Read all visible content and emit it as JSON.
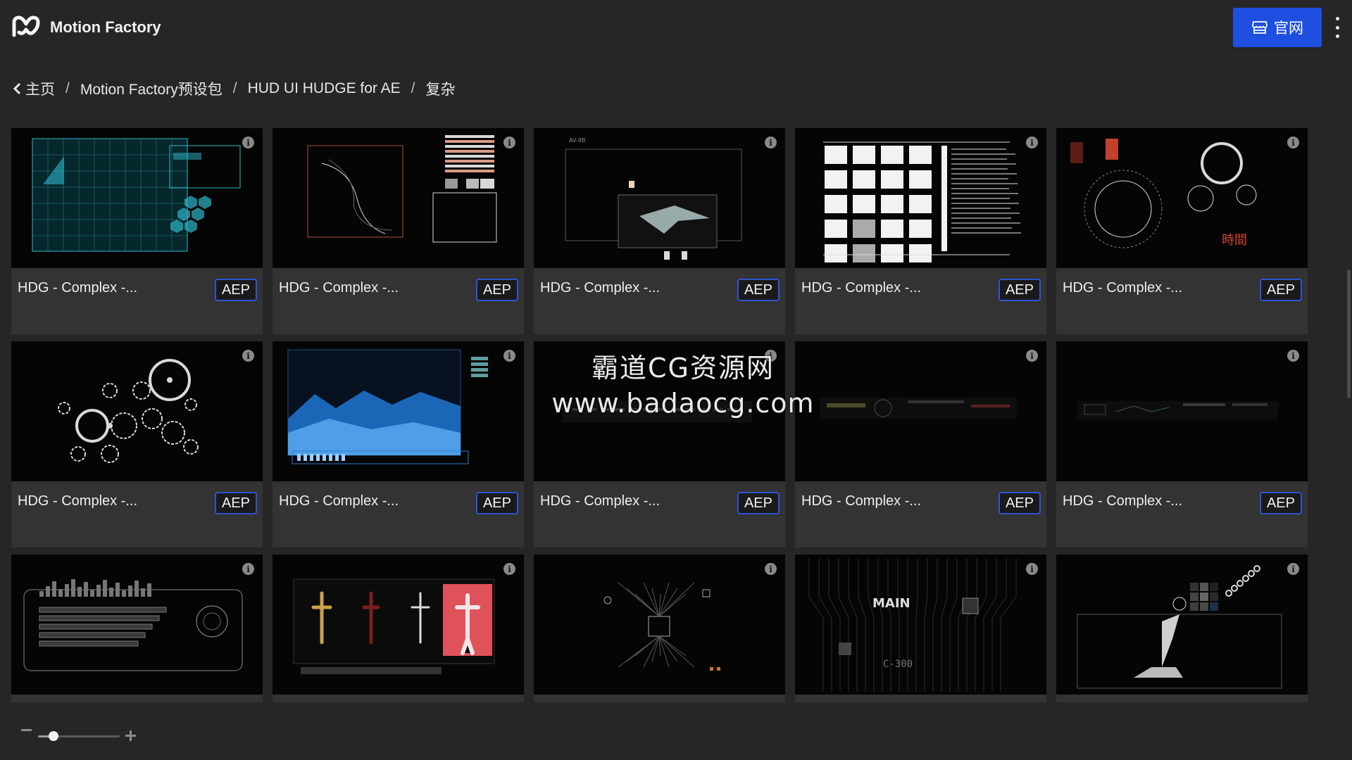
{
  "app": {
    "title": "Motion Factory",
    "logo_icon": "motion-factory-logo-icon"
  },
  "header": {
    "site_button_label": "官网",
    "site_button_icon": "store-icon",
    "more_icon": "more-vertical-icon",
    "accent": "#1f4fe0"
  },
  "breadcrumb": {
    "back_icon": "chevron-left-icon",
    "items": [
      "主页",
      "Motion Factory预设包",
      "HUD UI HUDGE for AE",
      "复杂"
    ],
    "separator": "/"
  },
  "grid": {
    "cards": [
      {
        "title": "HDG - Complex -...",
        "badge": "AEP",
        "thumb": "grid-panel"
      },
      {
        "title": "HDG - Complex -...",
        "badge": "AEP",
        "thumb": "dna-panel"
      },
      {
        "title": "HDG - Complex -...",
        "badge": "AEP",
        "thumb": "jet-panel"
      },
      {
        "title": "HDG - Complex -...",
        "badge": "AEP",
        "thumb": "folder-grid"
      },
      {
        "title": "HDG - Complex -...",
        "badge": "AEP",
        "thumb": "circles-red"
      },
      {
        "title": "HDG - Complex -...",
        "badge": "AEP",
        "thumb": "gears"
      },
      {
        "title": "HDG - Complex -...",
        "badge": "AEP",
        "thumb": "terrain"
      },
      {
        "title": "HDG - Complex -...",
        "badge": "AEP",
        "thumb": "dark-strip"
      },
      {
        "title": "HDG - Complex -...",
        "badge": "AEP",
        "thumb": "dark-strip-2"
      },
      {
        "title": "HDG - Complex -...",
        "badge": "AEP",
        "thumb": "dark-strip-3"
      },
      {
        "title": "",
        "badge": "",
        "thumb": "city-bars"
      },
      {
        "title": "",
        "badge": "",
        "thumb": "bodies"
      },
      {
        "title": "",
        "badge": "",
        "thumb": "circuit"
      },
      {
        "title": "",
        "badge": "",
        "thumb": "motherboard"
      },
      {
        "title": "",
        "badge": "",
        "thumb": "microscope"
      }
    ],
    "info_icon": "info-icon"
  },
  "watermark": {
    "line1": "霸道CG资源网",
    "line2": "www.badaocg.com"
  },
  "zoom": {
    "value": 0.19,
    "minus_icon": "zoom-out-icon",
    "plus_icon": "zoom-in-icon"
  }
}
